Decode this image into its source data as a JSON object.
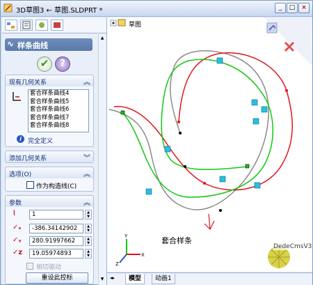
{
  "window": {
    "title": "3D草图3 ← 草图.SLDPRT *",
    "min_label": "_",
    "max_label": "□",
    "close_label": "×"
  },
  "panel": {
    "header": "样条曲线",
    "existing_relations": {
      "title": "现有几何关系",
      "items": [
        "套合样条曲线4",
        "套合样条曲线5",
        "套合样条曲线6",
        "套合样条曲线7",
        "套合样条曲线8"
      ],
      "status": "完全定义"
    },
    "add_relations_title": "添加几何关系",
    "options": {
      "title": "选项(O)",
      "construction_label": "作为构造线(C)"
    },
    "parameters": {
      "title": "参数",
      "count": "1",
      "x": "-386.34142902",
      "y": "280.91997662",
      "z": "19.05974893",
      "tangent_label": "相切驱动",
      "reset_label": "重设此控标"
    }
  },
  "graphics": {
    "tree_label": "草图",
    "annotation": "套合样条"
  },
  "bottom_tabs": [
    "模型",
    "动画1"
  ],
  "watermark": "DedeCmsV3",
  "colors": {
    "spline_red": "#e0141c",
    "spline_green": "#12c812",
    "spline_gray": "#8a8a8a",
    "accent": "#5a79ab"
  }
}
